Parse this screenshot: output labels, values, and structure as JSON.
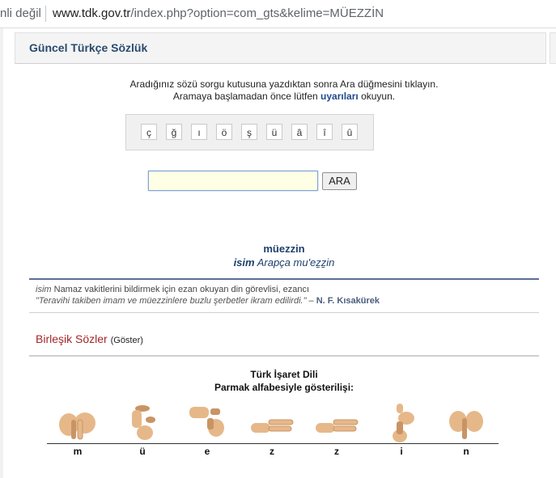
{
  "browser": {
    "security_text": "nli değil",
    "url_domain": "www.tdk.gov.tr",
    "url_path": "/index.php?option=com_gts&kelime=MÜEZZİN"
  },
  "panel": {
    "title": "Güncel Türkçe Sözlük"
  },
  "instructions": {
    "line1": "Aradığınız sözü sorgu kutusuna yazdıktan sonra Ara düğmesini tıklayın.",
    "line2_pre": "Aramaya başlamadan önce lütfen",
    "line2_link": "uyarıları",
    "line2_post": "okuyun."
  },
  "keyboard": {
    "keys": [
      "ç",
      "ğ",
      "ı",
      "ö",
      "ş",
      "ü",
      "â",
      "î",
      "û"
    ]
  },
  "search": {
    "value": "",
    "button_label": "ARA"
  },
  "entry": {
    "word": "müezzin",
    "pos": "isim",
    "origin": "Arapça mu'eẕẕin",
    "def_pos": "isim",
    "definition": "Namaz vakitlerini bildirmek için ezan okuyan din görevlisi, ezancı",
    "example": "\"Teravihi takiben imam ve müezzinlere buzlu şerbetler ikram edilirdi.\"",
    "example_dash": "–",
    "example_author": "N. F. Kısakürek"
  },
  "compounds": {
    "title": "Birleşik Sözler",
    "toggle": "(Göster)"
  },
  "sign_language": {
    "title": "Türk İşaret Dili",
    "subtitle": "Parmak alfabesiyle gösterilişi:",
    "letters": [
      "m",
      "ü",
      "e",
      "z",
      "z",
      "i",
      "n"
    ]
  },
  "colors": {
    "skin": "#e6b889",
    "skin_shadow": "#c99465",
    "accent_blue": "#1f3f6c",
    "compound_red": "#a3272a"
  }
}
